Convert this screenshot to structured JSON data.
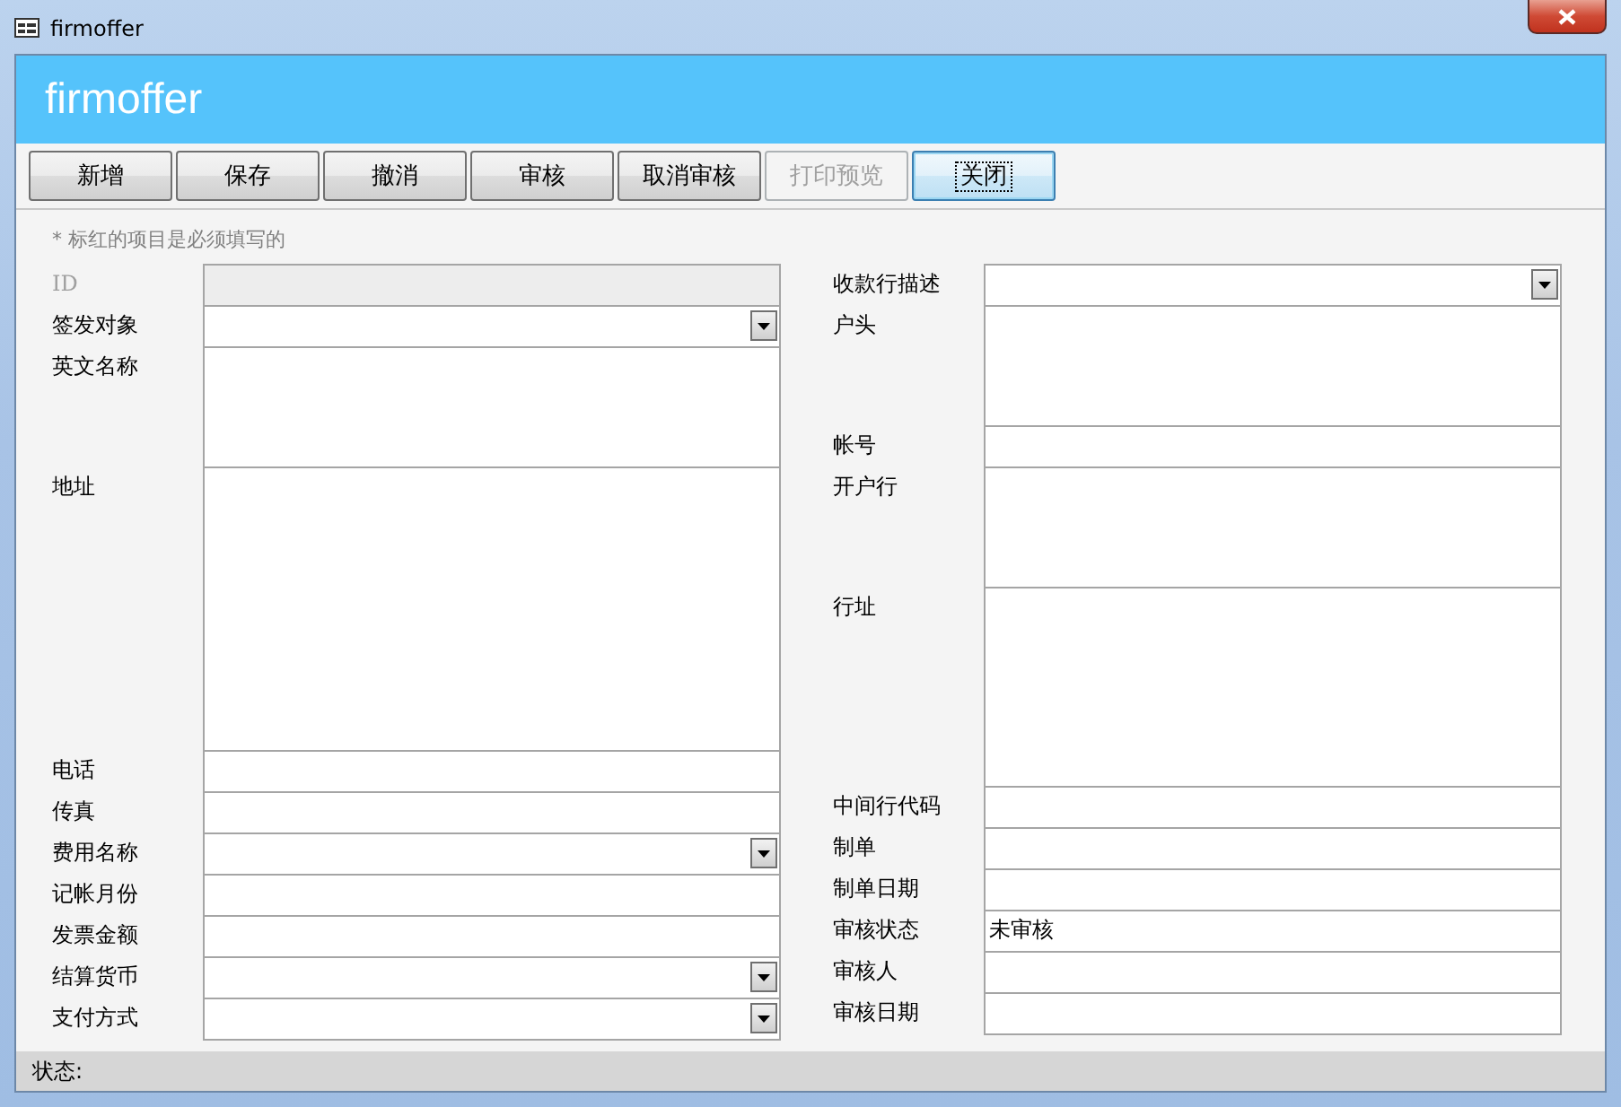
{
  "window": {
    "title": "firmoffer"
  },
  "header": {
    "title": "firmoffer"
  },
  "toolbar": [
    {
      "label": "新增",
      "disabled": false,
      "focused": false
    },
    {
      "label": "保存",
      "disabled": false,
      "focused": false
    },
    {
      "label": "撤消",
      "disabled": false,
      "focused": false
    },
    {
      "label": "审核",
      "disabled": false,
      "focused": false
    },
    {
      "label": "取消审核",
      "disabled": false,
      "focused": false
    },
    {
      "label": "打印预览",
      "disabled": true,
      "focused": false
    },
    {
      "label": "关闭",
      "disabled": false,
      "focused": true
    }
  ],
  "note": "* 标红的项目是必须填写的",
  "left_fields": [
    {
      "label": "ID",
      "kind": "text",
      "disabled": true
    },
    {
      "label": "签发对象",
      "kind": "combo",
      "disabled": false
    },
    {
      "label": "英文名称",
      "kind": "memo",
      "disabled": false
    },
    {
      "label": "地址",
      "kind": "long-memo",
      "disabled": false
    },
    {
      "label": "电话",
      "kind": "text",
      "disabled": false
    },
    {
      "label": "传真",
      "kind": "text",
      "disabled": false
    },
    {
      "label": "费用名称",
      "kind": "combo",
      "disabled": false
    },
    {
      "label": "记帐月份",
      "kind": "text",
      "disabled": false
    },
    {
      "label": "发票金额",
      "kind": "text",
      "disabled": false
    },
    {
      "label": "结算货币",
      "kind": "combo",
      "disabled": false
    },
    {
      "label": "支付方式",
      "kind": "combo",
      "disabled": false
    }
  ],
  "right_fields": [
    {
      "label": "收款行描述",
      "kind": "combo",
      "disabled": false
    },
    {
      "label": "户头",
      "kind": "memo",
      "disabled": false
    },
    {
      "label": "帐号",
      "kind": "text",
      "disabled": false
    },
    {
      "label": "开户行",
      "kind": "memo",
      "disabled": false
    },
    {
      "label": "行址",
      "kind": "tall-memo",
      "disabled": false
    },
    {
      "label": "中间行代码",
      "kind": "text",
      "disabled": false
    },
    {
      "label": "制单",
      "kind": "text",
      "disabled": false
    },
    {
      "label": "制单日期",
      "kind": "text",
      "disabled": false
    },
    {
      "label": "审核状态",
      "kind": "text",
      "disabled": false,
      "value": "未审核"
    },
    {
      "label": "审核人",
      "kind": "text",
      "disabled": false
    },
    {
      "label": "审核日期",
      "kind": "text",
      "disabled": false
    }
  ],
  "status_bar": {
    "label": "状态:"
  }
}
